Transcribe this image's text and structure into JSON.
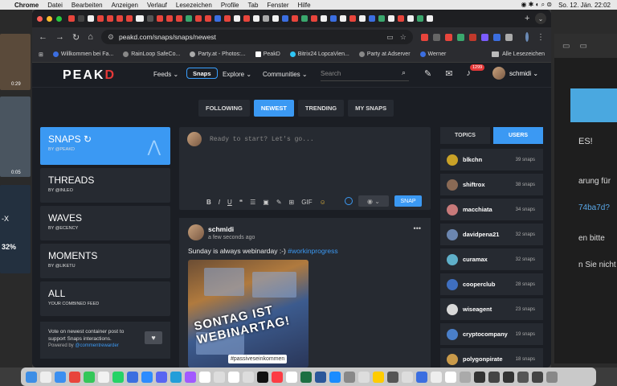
{
  "os_menu": {
    "app": "Chrome",
    "items": [
      "Datei",
      "Bearbeiten",
      "Anzeigen",
      "Verlauf",
      "Lesezeichen",
      "Profile",
      "Tab",
      "Fenster",
      "Hilfe"
    ],
    "clock": "So. 12. Jän.  22:02"
  },
  "desktop_left": {
    "time1": "0:29",
    "time2": "0:05",
    "label1": "-X",
    "pct": "32%"
  },
  "background_window": {
    "lines": [
      "ES!",
      "arung für",
      "74ba7d?",
      "en bitte",
      "n Sie nicht"
    ]
  },
  "browser": {
    "url": "peakd.com/snaps/snaps/newest",
    "bookmarks": [
      "Willkommen bei Fa...",
      "RainLoop SafeCo...",
      "Party.at - Photos:...",
      "PeakD",
      "Bitrix24 LopcaVien...",
      "Party at Adserver",
      "Werner"
    ],
    "all_bookmarks": "Alle Lesezeichen"
  },
  "peakd": {
    "logo_main": "PEAK",
    "logo_accent": "D",
    "nav": {
      "feeds": "Feeds ⌄",
      "snaps": "Snaps",
      "explore": "Explore ⌄",
      "communities": "Communities ⌄"
    },
    "search_placeholder": "Search",
    "notifications": "1299",
    "username": "schmidi ⌄",
    "subtabs": [
      "FOLLOWING",
      "NEWEST",
      "TRENDING",
      "MY SNAPS"
    ],
    "feeds_list": [
      {
        "name": "SNAPS ↻",
        "by": "BY @PEAKD"
      },
      {
        "name": "THREADS",
        "by": "BY @INLEO"
      },
      {
        "name": "WAVES",
        "by": "BY @ECENCY"
      },
      {
        "name": "MOMENTS",
        "by": "BY @LIKETU"
      },
      {
        "name": "ALL",
        "by": "YOUR COMBINED FEED"
      }
    ],
    "vote_note": {
      "text": "Vote on newest container post to support Snaps interactions.",
      "powered": "Powered by",
      "powered_link": "@commentrewarder"
    },
    "composer": {
      "placeholder": "Ready to start? Let's go...",
      "tools": [
        "B",
        "I",
        "U",
        "❝",
        "☰",
        "▣",
        "✎",
        "⊞",
        "GIF",
        "☺"
      ],
      "button": "SNAP"
    },
    "post": {
      "author": "schmidi",
      "time": "a few seconds ago",
      "text": "Sunday is always webinarday :-) ",
      "hashtag": "#workinprogress",
      "image_overlay": "SONTAG IST WEBINARTAG!",
      "image_tag": "#passiveseinkommen"
    },
    "side_tabs": [
      "TOPICS",
      "USERS"
    ],
    "users": [
      {
        "name": "blkchn",
        "count": "39 snaps",
        "color": "#c9a227"
      },
      {
        "name": "shiftrox",
        "count": "38 snaps",
        "color": "#8a6a55"
      },
      {
        "name": "macchiata",
        "count": "34 snaps",
        "color": "#c87a7a"
      },
      {
        "name": "davidpena21",
        "count": "32 snaps",
        "color": "#6b86b0"
      },
      {
        "name": "curamax",
        "count": "32 snaps",
        "color": "#5fb0c9"
      },
      {
        "name": "cooperclub",
        "count": "28 snaps",
        "color": "#3f6fc0"
      },
      {
        "name": "wiseagent",
        "count": "23 snaps",
        "color": "#d9d9d9"
      },
      {
        "name": "cryptocompany",
        "count": "19 snaps",
        "color": "#4a7fc9"
      },
      {
        "name": "polygonpirate",
        "count": "18 snaps",
        "color": "#c99a4a"
      }
    ]
  }
}
